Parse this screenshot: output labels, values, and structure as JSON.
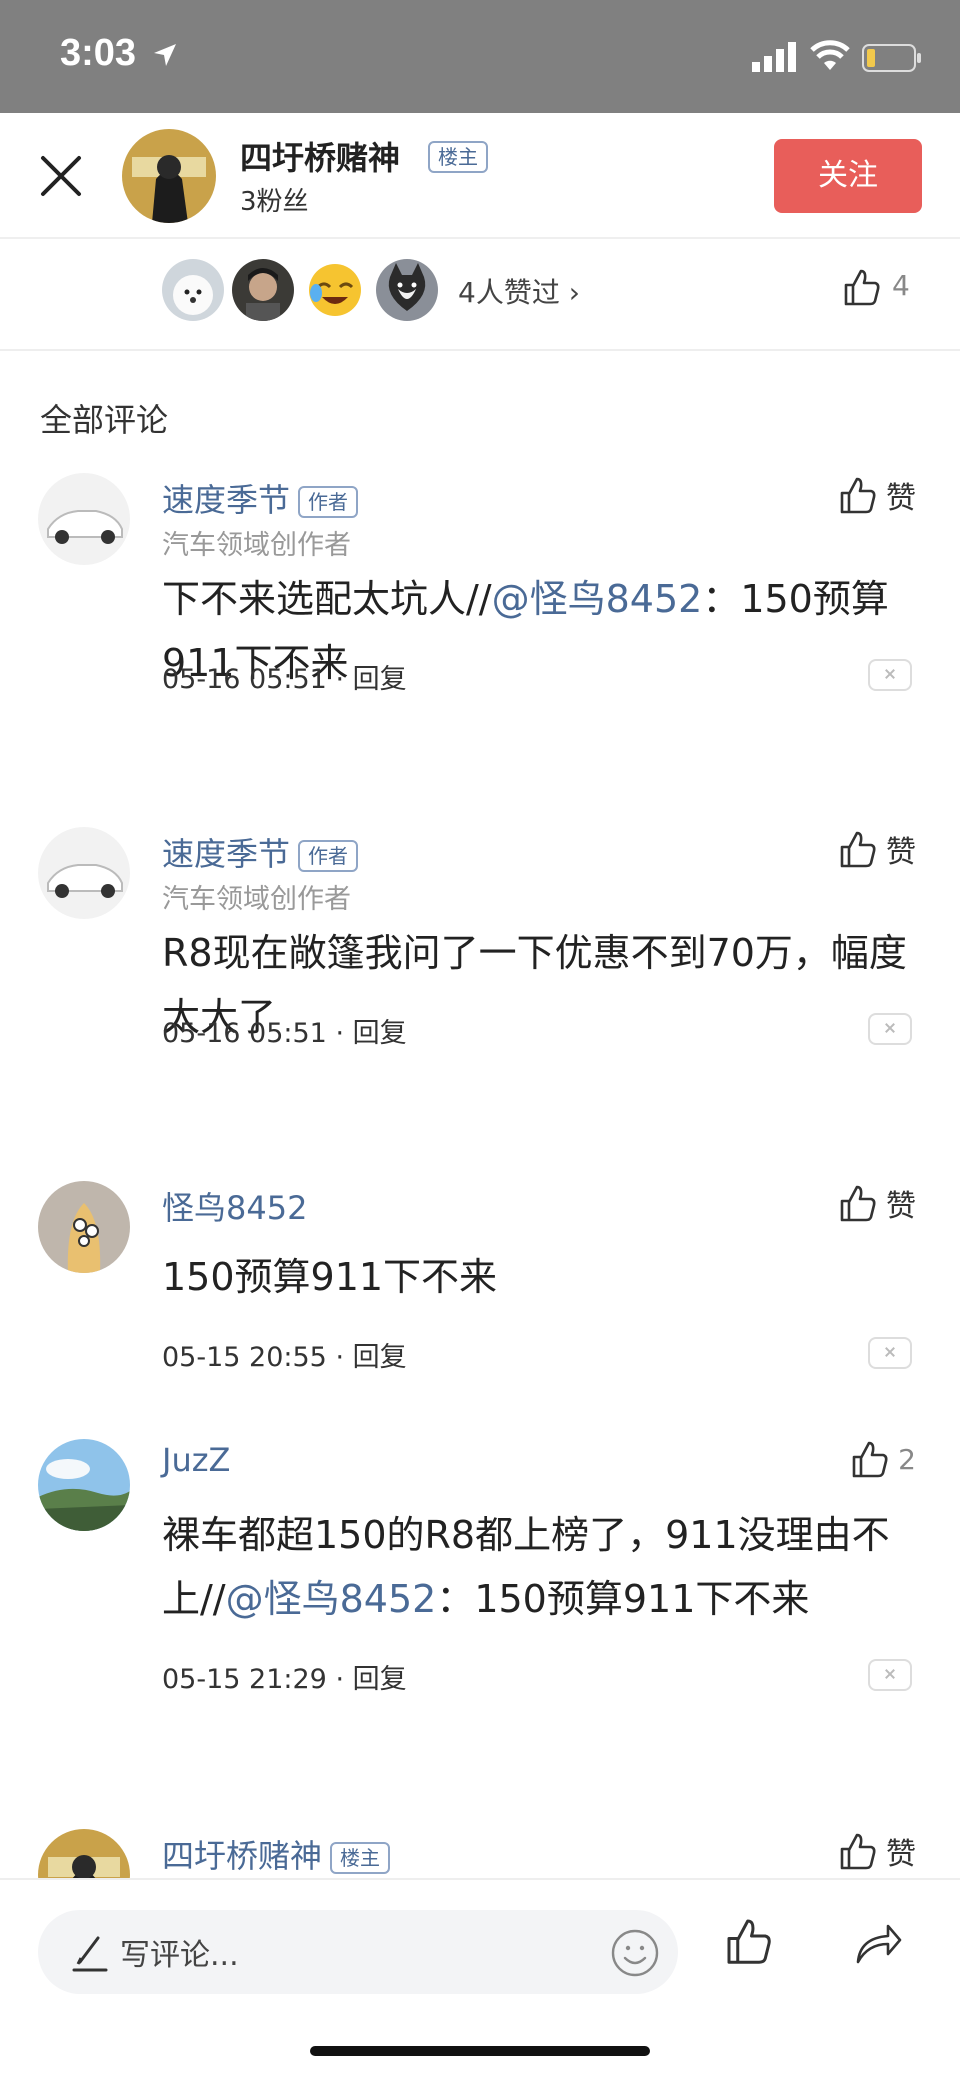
{
  "status_bar": {
    "time": "3:03"
  },
  "header": {
    "username": "四圩桥赌神",
    "badge": "楼主",
    "fans": "3粉丝",
    "follow_label": "关注"
  },
  "likers": {
    "summary": "4人赞过 ›",
    "like_count": "4"
  },
  "section_title": "全部评论",
  "comments": [
    {
      "name": "速度季节",
      "badge": "作者",
      "sub": "汽车领域创作者",
      "text_plain": "下不来选配太坑人//",
      "mention": "@怪鸟8452",
      "text_after": "：150预算911下不来",
      "time": "05-16 05:51",
      "reply": "回复",
      "like_label": "赞"
    },
    {
      "name": "速度季节",
      "badge": "作者",
      "sub": "汽车领域创作者",
      "text_plain": "R8现在敞篷我问了一下优惠不到70万，幅度太大了",
      "time": "05-16 05:51",
      "reply": "回复",
      "like_label": "赞"
    },
    {
      "name": "怪鸟8452",
      "text_plain": "150预算911下不来",
      "time": "05-15 20:55",
      "reply": "回复",
      "like_label": "赞"
    },
    {
      "name": "JuzZ",
      "text_plain": "裸车都超150的R8都上榜了，911没理由不上//",
      "mention": "@怪鸟8452",
      "text_after": "：150预算911下不来",
      "time": "05-15 21:29",
      "reply": "回复",
      "like_label": "2"
    },
    {
      "name": "四圩桥赌神",
      "badge": "楼主",
      "like_label": "赞"
    }
  ],
  "bottom_bar": {
    "placeholder": "写评论..."
  },
  "meta_separator": " · ",
  "colors": {
    "status_bar": "#808080",
    "follow_button": "#e85e5a",
    "link_blue": "#4a6a96",
    "secondary_text": "#999999"
  },
  "icons": [
    "close-icon",
    "location-arrow-icon",
    "signal-icon",
    "wifi-icon",
    "battery-icon",
    "thumbs-up-icon",
    "pen-icon",
    "smile-icon",
    "share-icon",
    "delete-icon"
  ]
}
